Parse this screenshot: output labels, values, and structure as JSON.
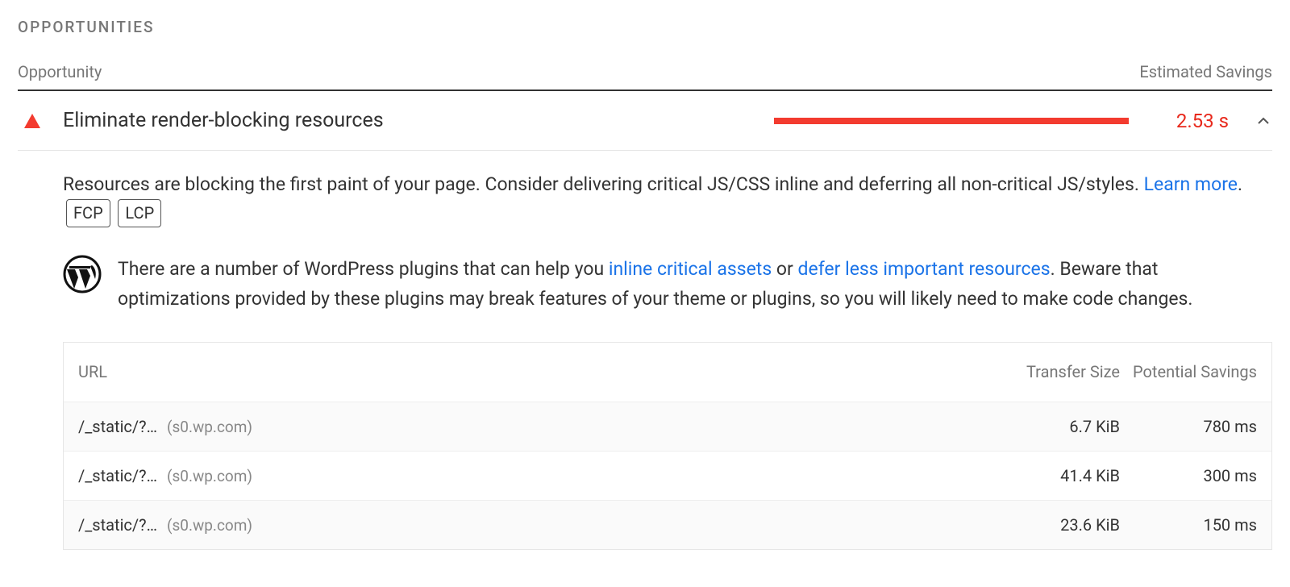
{
  "section_title": "OPPORTUNITIES",
  "columns": {
    "opportunity": "Opportunity",
    "estimated_savings": "Estimated Savings"
  },
  "opportunity": {
    "icon": "triangle-warning",
    "title": "Eliminate render-blocking resources",
    "savings_label": "2.53 s",
    "bar_color": "#f33b2f",
    "description_prefix": "Resources are blocking the first paint of your page. Consider delivering critical JS/CSS inline and deferring all non-critical JS/styles. ",
    "learn_more_label": "Learn more",
    "description_suffix": ".",
    "metrics": [
      "FCP",
      "LCP"
    ],
    "wordpress_hint": {
      "prefix": "There are a number of WordPress plugins that can help you ",
      "link1": "inline critical assets",
      "mid1": " or ",
      "link2": "defer less important resources",
      "suffix": ". Beware that optimizations provided by these plugins may break features of your theme or plugins, so you will likely need to make code changes."
    },
    "table": {
      "headers": {
        "url": "URL",
        "transfer_size": "Transfer Size",
        "potential_savings": "Potential Savings"
      },
      "rows": [
        {
          "path": "/_static/?…",
          "host": "(s0.wp.com)",
          "transfer_size": "6.7 KiB",
          "potential_savings": "780 ms"
        },
        {
          "path": "/_static/?…",
          "host": "(s0.wp.com)",
          "transfer_size": "41.4 KiB",
          "potential_savings": "300 ms"
        },
        {
          "path": "/_static/?…",
          "host": "(s0.wp.com)",
          "transfer_size": "23.6 KiB",
          "potential_savings": "150 ms"
        }
      ]
    }
  }
}
